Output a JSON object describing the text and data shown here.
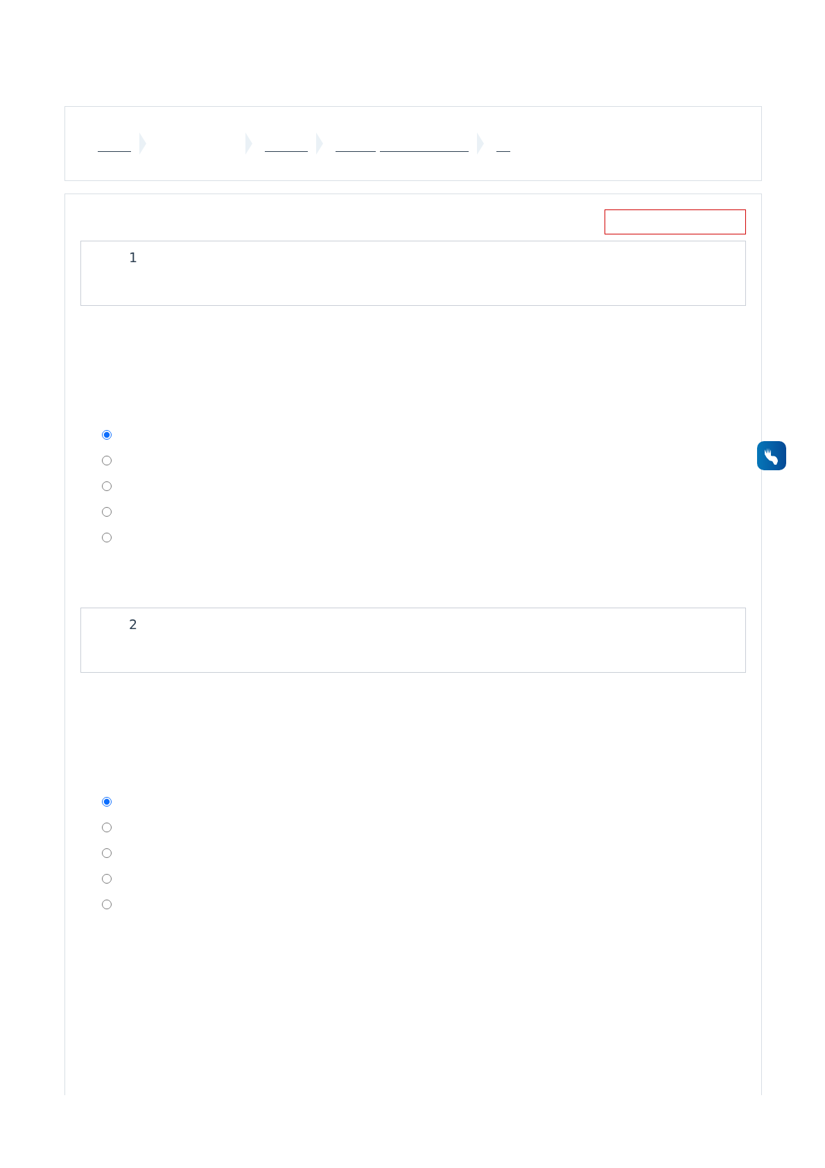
{
  "breadcrumb": [
    {
      "kind": "link"
    },
    {
      "kind": "blank"
    },
    {
      "kind": "link"
    },
    {
      "kind": "link_pair"
    },
    {
      "kind": "short_link"
    }
  ],
  "questions": [
    {
      "number": "1",
      "options": [
        {
          "selected": true
        },
        {
          "selected": false
        },
        {
          "selected": false
        },
        {
          "selected": false
        },
        {
          "selected": false
        }
      ]
    },
    {
      "number": "2",
      "options": [
        {
          "selected": true
        },
        {
          "selected": false
        },
        {
          "selected": false
        },
        {
          "selected": false
        },
        {
          "selected": false
        }
      ]
    }
  ]
}
